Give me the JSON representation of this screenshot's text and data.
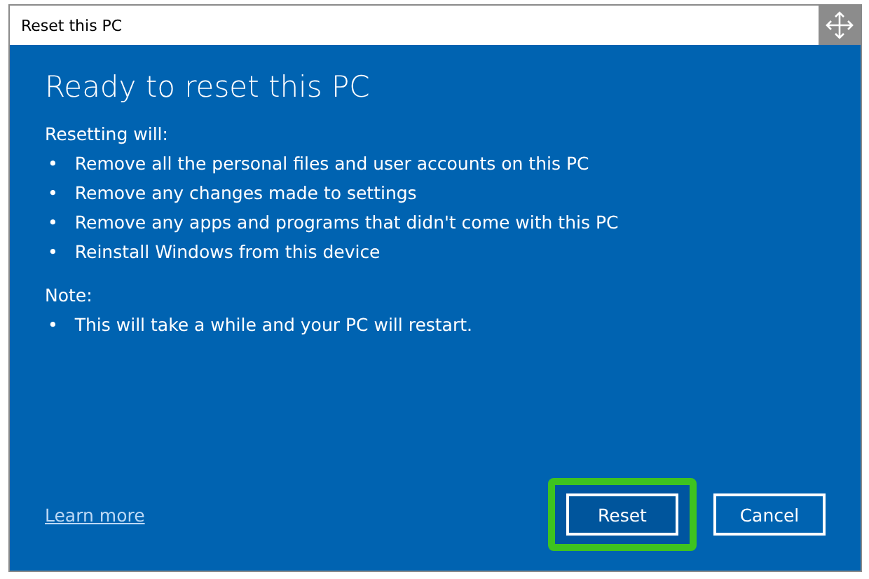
{
  "window": {
    "title": "Reset this PC"
  },
  "heading": "Ready to reset this PC",
  "sections": [
    {
      "label": "Resetting will:",
      "items": [
        {
          "bullet": "•",
          "text": "Remove all the personal files and user accounts on this PC"
        },
        {
          "bullet": "•",
          "text": "Remove any changes made to settings"
        },
        {
          "bullet": "•",
          "text": "Remove any apps and programs that didn't come with this PC"
        },
        {
          "bullet": "•",
          "text": "Reinstall Windows from this device"
        }
      ]
    },
    {
      "label": "Note:",
      "items": [
        {
          "bullet": "•",
          "text": "This will take a while and your PC will restart."
        }
      ]
    }
  ],
  "link": "Learn more",
  "buttons": [
    {
      "label": "Reset",
      "highlighted": true
    },
    {
      "label": "Cancel",
      "highlighted": false
    }
  ]
}
